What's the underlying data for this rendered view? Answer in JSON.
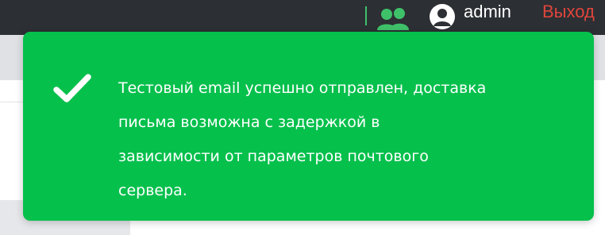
{
  "header": {
    "users_icon": "users-icon",
    "avatar_icon": "user-circle-icon",
    "username": "admin",
    "logout_label": "Выход",
    "colors": {
      "background": "#2c2f33",
      "accent": "#3fc16a",
      "logout": "#e0453c"
    }
  },
  "toast": {
    "type": "success",
    "icon": "checkmark-icon",
    "lines": [
      "Тестовый email успешно отправлен, доставка",
      "письма возможна с задержкой в",
      "зависимости от параметров почтового",
      "сервера."
    ],
    "colors": {
      "background": "#06c04c",
      "text": "#ffffff"
    }
  }
}
